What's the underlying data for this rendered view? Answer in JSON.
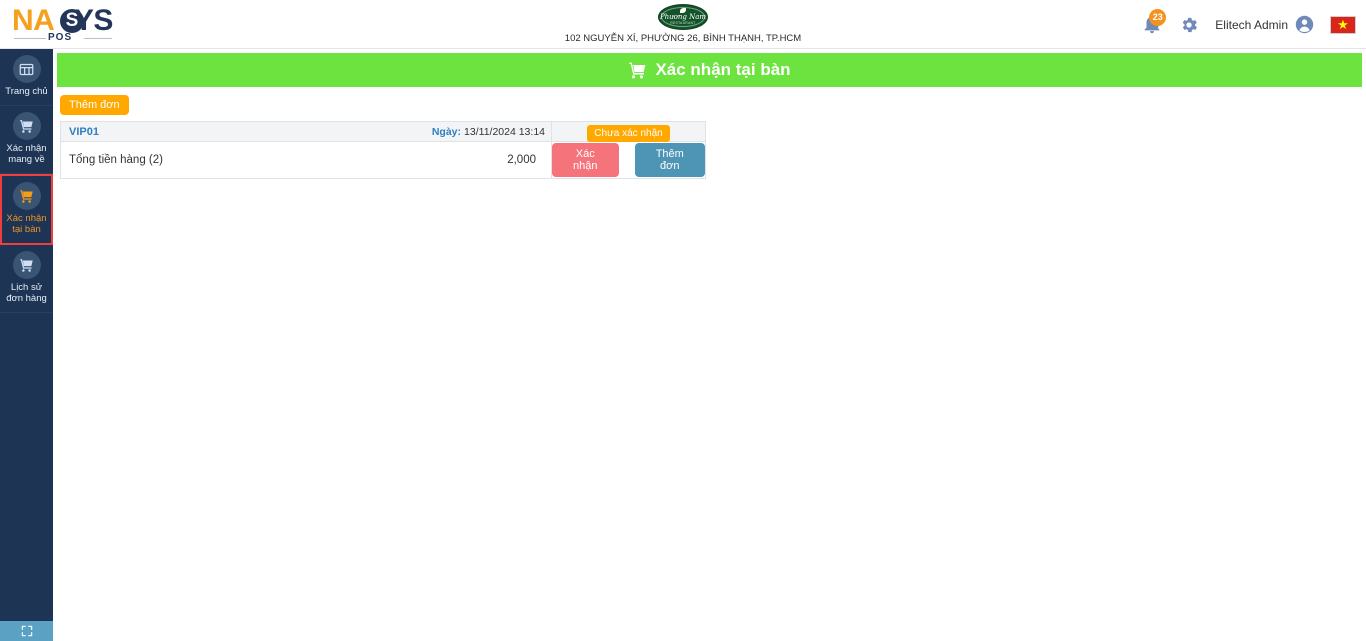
{
  "navbar": {
    "logo": {
      "part1": "NA",
      "part_circle": "S",
      "part2": "YS",
      "sub": "POS"
    },
    "store": {
      "badge_name": "Phương Nam",
      "badge_sub": "RESTAURANT",
      "address": "102 NGUYỄN XÍ, PHƯỜNG 26, BÌNH THẠNH, TP.HCM"
    },
    "notifications": {
      "icon": "bell-icon",
      "count": "23"
    },
    "settings": {
      "icon": "gear-icon"
    },
    "user": {
      "name": "Elitech Admin",
      "icon": "user-avatar-icon"
    },
    "language": {
      "icon": "vietnam-flag-icon",
      "star": "★"
    }
  },
  "sidebar": {
    "items": [
      {
        "label": "Trang chủ",
        "icon": "dashboard-grid-icon",
        "active": false
      },
      {
        "label": "Xác nhận mang về",
        "icon": "shopping-cart-icon",
        "active": false
      },
      {
        "label": "Xác nhận tại bàn",
        "icon": "shopping-cart-icon",
        "active": true
      },
      {
        "label": "Lịch sử đơn hàng",
        "icon": "shopping-cart-icon",
        "active": false
      }
    ],
    "fullscreen": {
      "icon": "fullscreen-expand-icon"
    }
  },
  "main": {
    "banner": {
      "icon": "shopping-cart-icon",
      "title": "Xác nhận tại bàn"
    },
    "add_order_button": "Thêm đơn",
    "order": {
      "table_code": "VIP01",
      "date_label": "Ngày:",
      "date_value": "13/11/2024 13:14",
      "status": "Chưa xác nhận",
      "total_label": "Tổng tiền hàng (2)",
      "total_value": "2,000",
      "confirm_button": "Xác nhận",
      "add_button": "Thêm đơn"
    }
  },
  "colors": {
    "sidebar_bg": "#1d3454",
    "banner_green": "#6ce33e",
    "accent_orange": "#ffa900",
    "active_border_red": "#f03e3e",
    "confirm_red": "#f5737b",
    "add_blue": "#4d94b5",
    "link_blue": "#2f7fc1"
  }
}
